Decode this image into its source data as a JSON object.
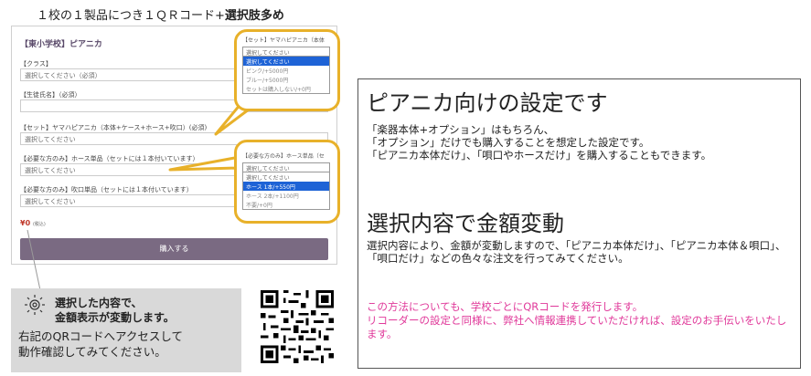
{
  "heading": {
    "prefix": "１校の１製品につき１ＱＲコード+",
    "emphasis": "選択肢多め"
  },
  "form": {
    "product_title": "【東小学校】ピアニカ",
    "class_label": "【クラス】",
    "class_placeholder": "選択してください（必須）",
    "name_label": "【生徒氏名】（必須）",
    "set_label": "【セット】ヤマハピアニカ（本体+ケース+ホース+吹口）(必須)",
    "set_placeholder": "選択してください",
    "hose_label": "【必要な方のみ】ホース単品（セットには１本付いています）",
    "hose_placeholder": "選択してください",
    "mouth_label": "【必要な方のみ】吹口単品（セットには１本付いています）",
    "mouth_placeholder": "選択してください",
    "price": "¥0",
    "price_tax": "(税込)",
    "buy_button": "購入する"
  },
  "dropdown_set": {
    "title": "【セット】ヤマハピアニカ（本体",
    "selected": "選択してください",
    "options": [
      "選択してください",
      "ピンク/+5000円",
      "ブルー/+5000円",
      "セットは購入しない/+0円"
    ]
  },
  "dropdown_hose": {
    "title": "【必要な方のみ】ホース単品（セ",
    "selected": "選択してください",
    "options": [
      "選択してください",
      "ホース 1本/+550円",
      "ホース 2本/+1100円",
      "不要/+0円"
    ]
  },
  "panel": {
    "title1": "ピアニカ向けの設定です",
    "body1": "「楽器本体+オプション」はもちろん、\n「オプション」だけでも購入することを想定した設定です。\n「ピアニカ本体だけ」、「唄口やホースだけ」を購入することもできます。",
    "title2": "選択内容で金額変動",
    "body2": "選択内容により、金額が変動しますので、「ピアニカ本体だけ」、「ピアニカ本体＆唄口」、「唄口だけ」などの色々な注文を行ってみてください。",
    "body3": "この方法についても、学校ごとにQRコードを発行します。\nリコーダーの設定と同様に、弊社へ情報連携していただければ、設定のお手伝いをいたします。"
  },
  "note": {
    "bold_line1": "選択した内容で、",
    "bold_line2": "金額表示が変動します。",
    "text_line1": "右記のQRコードへアクセスして",
    "text_line2": "動作確認してみてください。"
  },
  "colors": {
    "accent_yellow": "#e8b12a",
    "button_purple": "#7a6a82",
    "highlight_blue": "#1e63d6",
    "pink_text": "#e0399a"
  }
}
